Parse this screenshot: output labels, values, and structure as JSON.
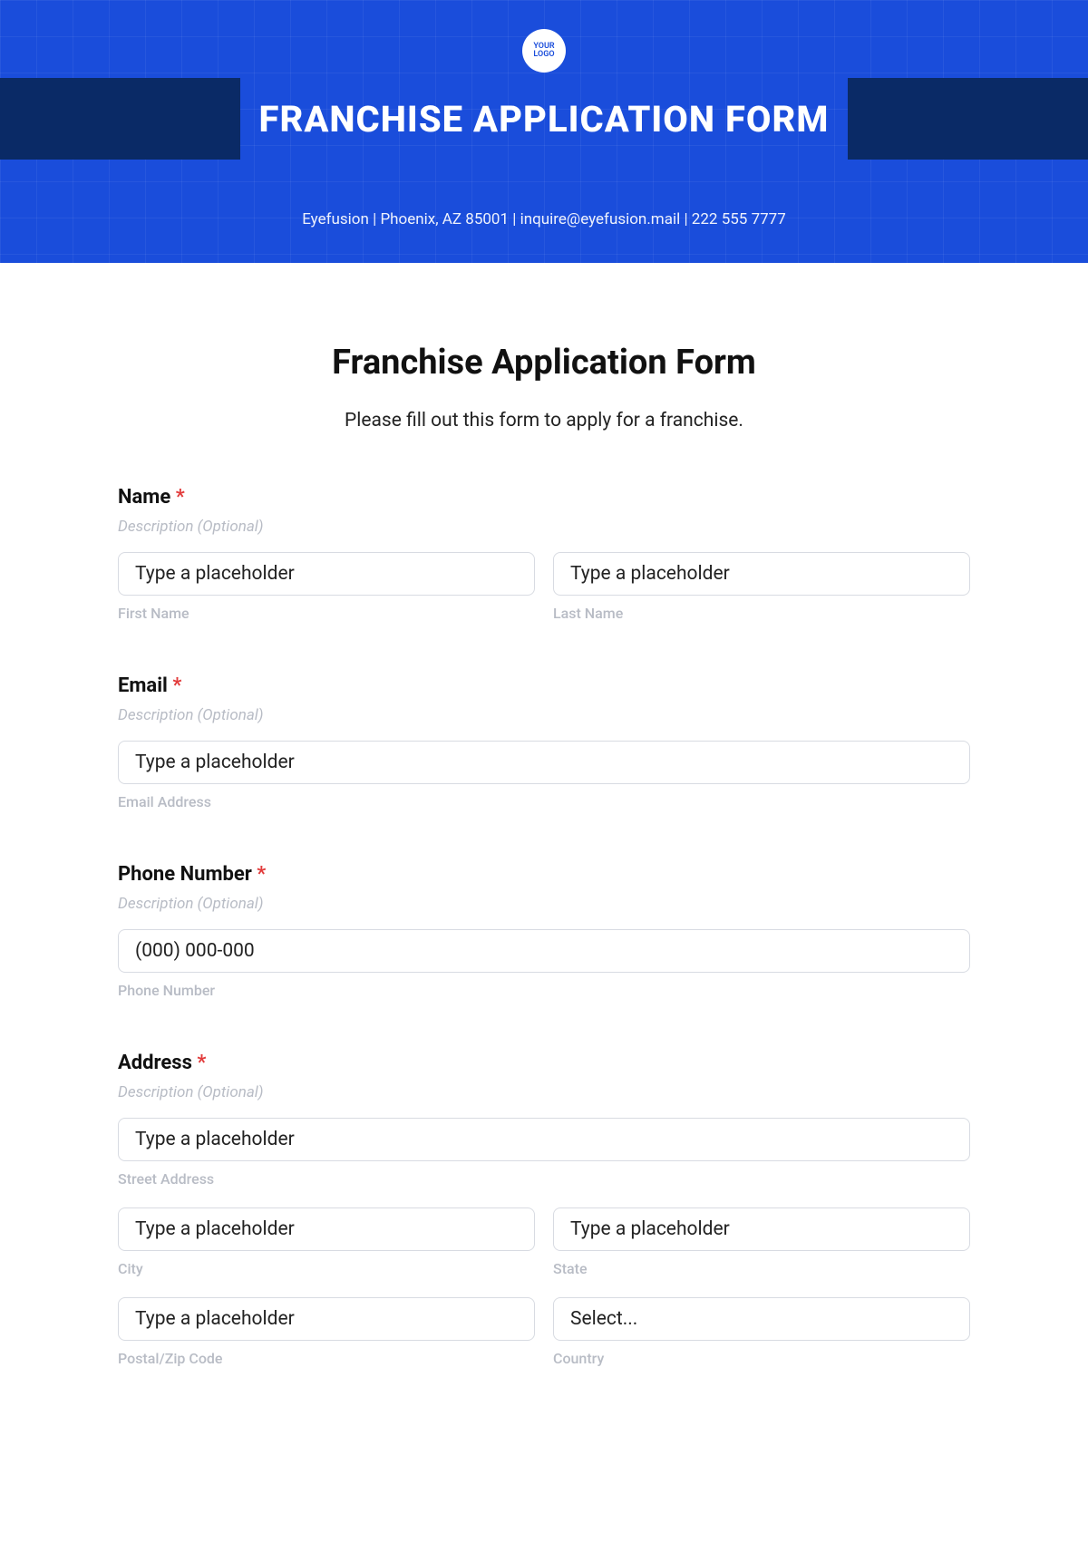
{
  "header": {
    "logo_text": "YOUR LOGO",
    "title": "FRANCHISE APPLICATION FORM",
    "contact_line": "Eyefusion | Phoenix, AZ 85001 | inquire@eyefusion.mail | 222 555 7777"
  },
  "form": {
    "title": "Franchise Application Form",
    "subtitle": "Please fill out this form to apply for a franchise.",
    "required_mark": "*",
    "desc_placeholder": "Description (Optional)",
    "fields": {
      "name": {
        "label": "Name",
        "first_placeholder": "Type a placeholder",
        "first_sub": "First Name",
        "last_placeholder": "Type a placeholder",
        "last_sub": "Last Name"
      },
      "email": {
        "label": "Email",
        "placeholder": "Type a placeholder",
        "sub": "Email Address"
      },
      "phone": {
        "label": "Phone Number",
        "placeholder": "(000) 000-000",
        "sub": "Phone Number"
      },
      "address": {
        "label": "Address",
        "street_placeholder": "Type a placeholder",
        "street_sub": "Street Address",
        "city_placeholder": "Type a placeholder",
        "city_sub": "City",
        "state_placeholder": "Type a placeholder",
        "state_sub": "State",
        "postal_placeholder": "Type a placeholder",
        "postal_sub": "Postal/Zip Code",
        "country_placeholder": "Select...",
        "country_sub": "Country"
      }
    }
  }
}
